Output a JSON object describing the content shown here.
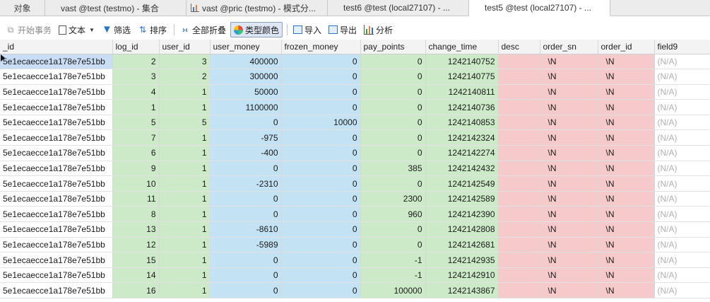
{
  "tabs": [
    {
      "label": "对象",
      "icon": "none",
      "active": false
    },
    {
      "label": "vast @test (testmo) - 集合",
      "icon": "grid-icon",
      "active": false
    },
    {
      "label": "vast @pric (testmo) - 模式分...",
      "icon": "chart-icon",
      "active": false
    },
    {
      "label": "test6 @test (local27107) - ...",
      "icon": "grid-icon",
      "active": false
    },
    {
      "label": "test5 @test (local27107) - ...",
      "icon": "grid-icon",
      "active": true
    }
  ],
  "toolbar": {
    "begin_transaction": "开始事务",
    "text": "文本",
    "filter": "筛选",
    "sort": "排序",
    "collapse_all": "全部折叠",
    "type_color": "类型颜色",
    "import": "导入",
    "export": "导出",
    "analyze": "分析"
  },
  "columns": [
    "_id",
    "log_id",
    "user_id",
    "user_money",
    "frozen_money",
    "pay_points",
    "change_time",
    "desc",
    "order_sn",
    "order_id",
    "field9"
  ],
  "rows": [
    [
      "5e1ecaecce1a178e7e51bb",
      "2",
      "3",
      "400000",
      "0",
      "0",
      "1242140752",
      "",
      "\\N",
      "\\N",
      "(N/A)"
    ],
    [
      "5e1ecaecce1a178e7e51bb",
      "3",
      "2",
      "300000",
      "0",
      "0",
      "1242140775",
      "",
      "\\N",
      "\\N",
      "(N/A)"
    ],
    [
      "5e1ecaecce1a178e7e51bb",
      "4",
      "1",
      "50000",
      "0",
      "0",
      "1242140811",
      "",
      "\\N",
      "\\N",
      "(N/A)"
    ],
    [
      "5e1ecaecce1a178e7e51bb",
      "1",
      "1",
      "1100000",
      "0",
      "0",
      "1242140736",
      "",
      "\\N",
      "\\N",
      "(N/A)"
    ],
    [
      "5e1ecaecce1a178e7e51bb",
      "5",
      "5",
      "0",
      "10000",
      "0",
      "1242140853",
      "",
      "\\N",
      "\\N",
      "(N/A)"
    ],
    [
      "5e1ecaecce1a178e7e51bb",
      "7",
      "1",
      "-975",
      "0",
      "0",
      "1242142324",
      "",
      "\\N",
      "\\N",
      "(N/A)"
    ],
    [
      "5e1ecaecce1a178e7e51bb",
      "6",
      "1",
      "-400",
      "0",
      "0",
      "1242142274",
      "",
      "\\N",
      "\\N",
      "(N/A)"
    ],
    [
      "5e1ecaecce1a178e7e51bb",
      "9",
      "1",
      "0",
      "0",
      "385",
      "1242142432",
      "",
      "\\N",
      "\\N",
      "(N/A)"
    ],
    [
      "5e1ecaecce1a178e7e51bb",
      "10",
      "1",
      "-2310",
      "0",
      "0",
      "1242142549",
      "",
      "\\N",
      "\\N",
      "(N/A)"
    ],
    [
      "5e1ecaecce1a178e7e51bb",
      "11",
      "1",
      "0",
      "0",
      "2300",
      "1242142589",
      "",
      "\\N",
      "\\N",
      "(N/A)"
    ],
    [
      "5e1ecaecce1a178e7e51bb",
      "8",
      "1",
      "0",
      "0",
      "960",
      "1242142390",
      "",
      "\\N",
      "\\N",
      "(N/A)"
    ],
    [
      "5e1ecaecce1a178e7e51bb",
      "13",
      "1",
      "-8610",
      "0",
      "0",
      "1242142808",
      "",
      "\\N",
      "\\N",
      "(N/A)"
    ],
    [
      "5e1ecaecce1a178e7e51bb",
      "12",
      "1",
      "-5989",
      "0",
      "0",
      "1242142681",
      "",
      "\\N",
      "\\N",
      "(N/A)"
    ],
    [
      "5e1ecaecce1a178e7e51bb",
      "15",
      "1",
      "0",
      "0",
      "-1",
      "1242142935",
      "",
      "\\N",
      "\\N",
      "(N/A)"
    ],
    [
      "5e1ecaecce1a178e7e51bb",
      "14",
      "1",
      "0",
      "0",
      "-1",
      "1242142910",
      "",
      "\\N",
      "\\N",
      "(N/A)"
    ],
    [
      "5e1ecaecce1a178e7e51bb",
      "16",
      "1",
      "0",
      "0",
      "100000",
      "1242143867",
      "",
      "\\N",
      "\\N",
      "(N/A)"
    ]
  ],
  "selected_row": 0,
  "colors": {
    "int_column": "#cdeac8",
    "number_column": "#c3e3f5",
    "string_column": "#f6c9cb",
    "null_text": "#b0b0b0",
    "selected_cell": "#c9ddf6"
  }
}
